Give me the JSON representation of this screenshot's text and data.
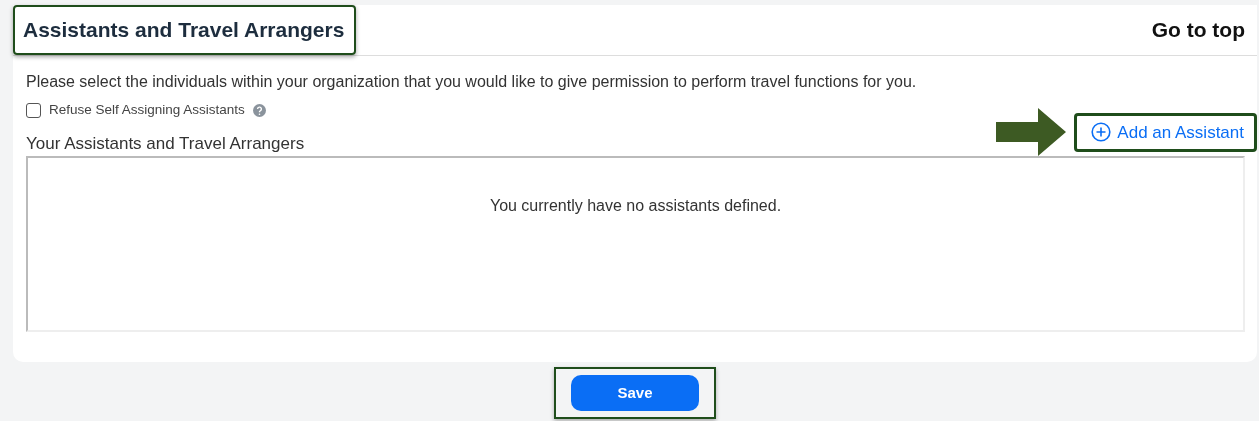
{
  "header": {
    "title": "Assistants and Travel Arrangers",
    "go_to_top": "Go to top"
  },
  "description": "Please select the individuals within your organization that you would like to give permission to perform travel functions for you.",
  "refuse_option": {
    "label": "Refuse Self Assigning Assistants",
    "checked": false
  },
  "section": {
    "label": "Your Assistants and Travel Arrangers",
    "add_link": "Add an Assistant",
    "empty_message": "You currently have no assistants defined."
  },
  "save_button": "Save"
}
